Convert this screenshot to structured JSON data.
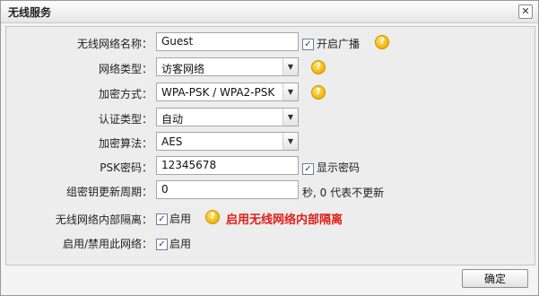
{
  "dialog": {
    "title": "无线服务",
    "close_glyph": "✕"
  },
  "form": {
    "ssid": {
      "label": "无线网络名称：",
      "value": "Guest",
      "broadcast_label": "开启广播",
      "broadcast_checked": true
    },
    "network_type": {
      "label": "网络类型：",
      "value": "访客网络"
    },
    "encryption_mode": {
      "label": "加密方式：",
      "value": "WPA-PSK / WPA2-PSK"
    },
    "auth_type": {
      "label": "认证类型：",
      "value": "自动"
    },
    "encryption_algorithm": {
      "label": "加密算法：",
      "value": "AES"
    },
    "psk_password": {
      "label": "PSK密码：",
      "value": "12345678",
      "show_label": "显示密码",
      "show_checked": true
    },
    "group_key_period": {
      "label": "组密钥更新周期：",
      "value": "0",
      "note": "秒, 0 代表不更新"
    },
    "isolation": {
      "label": "无线网络内部隔离：",
      "enable_label": "启用",
      "checked": true,
      "warning": "启用无线网络内部隔离"
    },
    "enable_network": {
      "label": "启用/禁用此网络：",
      "enable_label": "启用",
      "checked": true
    }
  },
  "icons": {
    "help_glyph": "?",
    "check_glyph": "✓",
    "dropdown_glyph": "▼"
  },
  "buttons": {
    "ok_label": "确定"
  },
  "colors": {
    "warning": "#e0201a",
    "help_icon": "#f3b400"
  }
}
